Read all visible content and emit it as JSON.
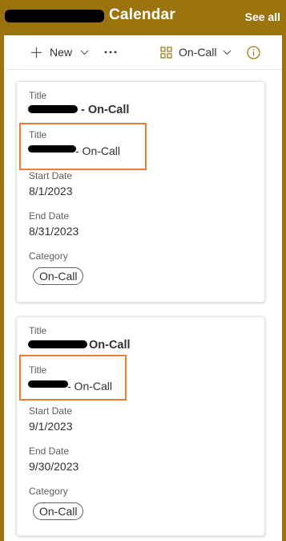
{
  "header": {
    "title": "Calendar",
    "see_all_label": "See all"
  },
  "toolbar": {
    "new_label": "New",
    "view_label": "On-Call"
  },
  "cards": [
    {
      "title_label": "Title",
      "title_value": "- On-Call",
      "second_title_label": "Title",
      "second_title_value": "- On-Call",
      "start_label": "Start Date",
      "start_value": "8/1/2023",
      "end_label": "End Date",
      "end_value": "8/31/2023",
      "category_label": "Category",
      "category_value": "On-Call"
    },
    {
      "title_label": "Title",
      "title_value": "On-Call",
      "second_title_label": "Title",
      "second_title_value": "- On-Call",
      "start_label": "Start Date",
      "start_value": "9/1/2023",
      "end_label": "End Date",
      "end_value": "9/30/2023",
      "category_label": "Category",
      "category_value": "On-Call"
    }
  ],
  "colors": {
    "header_background": "#9b7410",
    "highlight_box": "#f07c33"
  }
}
